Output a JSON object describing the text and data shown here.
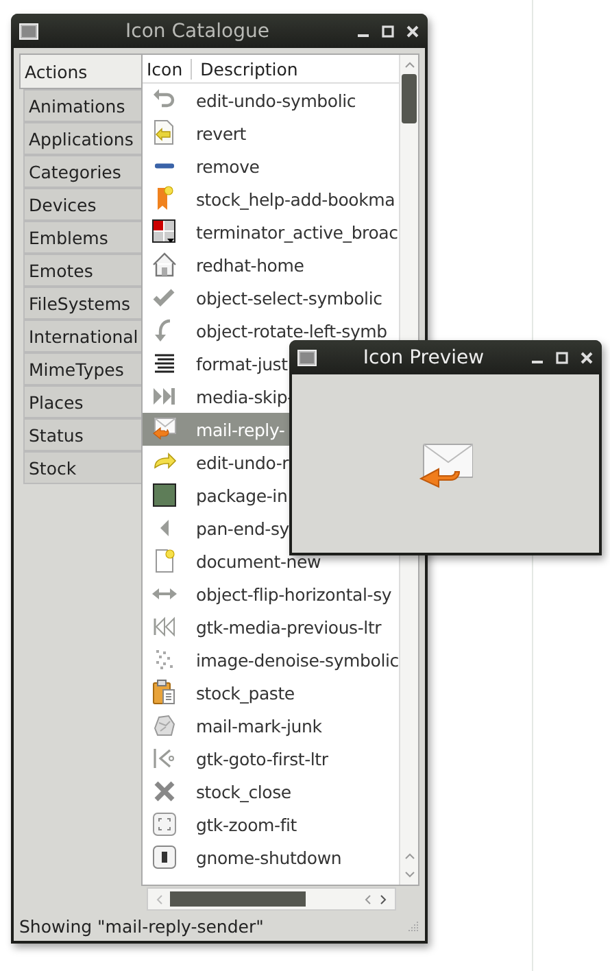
{
  "main_window": {
    "title": "Icon Catalogue"
  },
  "categories": [
    {
      "label": "Actions",
      "selected": true
    },
    {
      "label": "Animations",
      "selected": false
    },
    {
      "label": "Applications",
      "selected": false
    },
    {
      "label": "Categories",
      "selected": false
    },
    {
      "label": "Devices",
      "selected": false
    },
    {
      "label": "Emblems",
      "selected": false
    },
    {
      "label": "Emotes",
      "selected": false
    },
    {
      "label": "FileSystems",
      "selected": false
    },
    {
      "label": "International",
      "selected": false
    },
    {
      "label": "MimeTypes",
      "selected": false
    },
    {
      "label": "Places",
      "selected": false
    },
    {
      "label": "Status",
      "selected": false
    },
    {
      "label": "Stock",
      "selected": false
    }
  ],
  "table": {
    "columns": [
      "Icon",
      "Description"
    ],
    "rows": [
      {
        "description": "edit-undo-symbolic",
        "selected": false
      },
      {
        "description": "revert",
        "selected": false
      },
      {
        "description": "remove",
        "selected": false
      },
      {
        "description": "stock_help-add-bookma",
        "selected": false
      },
      {
        "description": "terminator_active_broac",
        "selected": false
      },
      {
        "description": "redhat-home",
        "selected": false
      },
      {
        "description": "object-select-symbolic",
        "selected": false
      },
      {
        "description": "object-rotate-left-symb",
        "selected": false
      },
      {
        "description": "format-just",
        "selected": false
      },
      {
        "description": "media-skip-",
        "selected": false
      },
      {
        "description": "mail-reply-",
        "selected": true
      },
      {
        "description": "edit-undo-r",
        "selected": false
      },
      {
        "description": "package-in",
        "selected": false
      },
      {
        "description": "pan-end-sy",
        "selected": false
      },
      {
        "description": "document-new",
        "selected": false
      },
      {
        "description": "object-flip-horizontal-sy",
        "selected": false
      },
      {
        "description": "gtk-media-previous-ltr",
        "selected": false
      },
      {
        "description": "image-denoise-symbolic",
        "selected": false
      },
      {
        "description": "stock_paste",
        "selected": false
      },
      {
        "description": "mail-mark-junk",
        "selected": false
      },
      {
        "description": "gtk-goto-first-ltr",
        "selected": false
      },
      {
        "description": "stock_close",
        "selected": false
      },
      {
        "description": "gtk-zoom-fit",
        "selected": false
      },
      {
        "description": "gnome-shutdown",
        "selected": false
      }
    ]
  },
  "status_bar": "Showing \"mail-reply-sender\"",
  "preview_window": {
    "title": "Icon Preview"
  }
}
